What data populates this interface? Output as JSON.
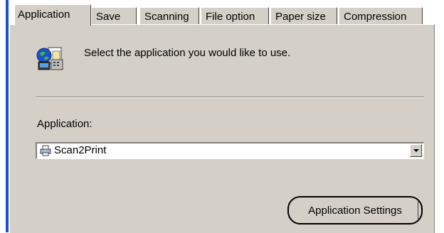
{
  "tabs": [
    {
      "label": "Application",
      "active": true
    },
    {
      "label": "Save",
      "active": false
    },
    {
      "label": "Scanning",
      "active": false
    },
    {
      "label": "File option",
      "active": false
    },
    {
      "label": "Paper size",
      "active": false
    },
    {
      "label": "Compression",
      "active": false
    }
  ],
  "header": {
    "icon": "application-settings-icon",
    "description": "Select the application you would like to use."
  },
  "application": {
    "label": "Application:",
    "selected": "Scan2Print",
    "selected_icon": "printer-icon"
  },
  "buttons": {
    "application_settings": "Application Settings"
  },
  "colors": {
    "panel": "#d4d0c8",
    "left_border": "#1f4fd0"
  }
}
